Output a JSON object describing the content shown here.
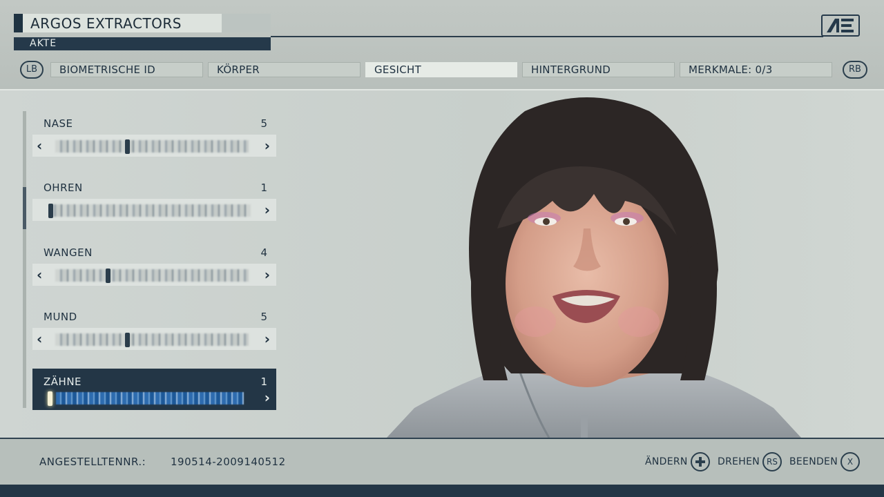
{
  "header": {
    "title": "ARGOS EXTRACTORS",
    "subtitle": "AKTE",
    "left_bumper": "LB",
    "right_bumper": "RB",
    "tabs": [
      {
        "label": "BIOMETRISCHE ID",
        "active": false
      },
      {
        "label": "KÖRPER",
        "active": false
      },
      {
        "label": "GESICHT",
        "active": true
      },
      {
        "label": "HINTERGRUND",
        "active": false
      },
      {
        "label": "MERKMALE: 0/3",
        "active": false
      }
    ]
  },
  "sliders": [
    {
      "label": "NASE",
      "value": "5",
      "has_left_arrow": true
    },
    {
      "label": "OHREN",
      "value": "1",
      "has_left_arrow": false
    },
    {
      "label": "WANGEN",
      "value": "4",
      "has_left_arrow": true
    },
    {
      "label": "MUND",
      "value": "5",
      "has_left_arrow": true
    },
    {
      "label": "ZÄHNE",
      "value": "1",
      "has_left_arrow": false,
      "selected": true
    }
  ],
  "footer": {
    "employee_label": "ANGESTELLTENNR.:",
    "employee_id": "190514-2009140512",
    "prompts": [
      {
        "label": "ÄNDERN",
        "button": "dpad-icon"
      },
      {
        "label": "DREHEN",
        "button": "RS"
      },
      {
        "label": "BEENDEN",
        "button": "X"
      }
    ]
  },
  "colors": {
    "accent_dark": "#233646",
    "header_bg": "#bcc4c1",
    "selection_blue": "#2f6fb5"
  }
}
